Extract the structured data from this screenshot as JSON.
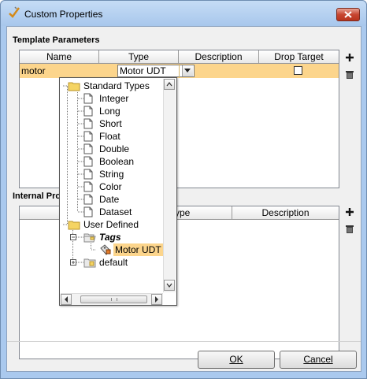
{
  "window": {
    "title": "Custom Properties"
  },
  "template_parameters": {
    "section_label": "Template Parameters",
    "columns": [
      "Name",
      "Type",
      "Description",
      "Drop Target"
    ],
    "rows": [
      {
        "name": "motor",
        "type": "Motor UDT",
        "description": "",
        "drop_target": false
      }
    ]
  },
  "type_dropdown": {
    "tree": [
      {
        "label": "Standard Types",
        "icon": "folder-icon",
        "expanded": true
      },
      {
        "label": "Integer",
        "icon": "page-icon"
      },
      {
        "label": "Long",
        "icon": "page-icon"
      },
      {
        "label": "Short",
        "icon": "page-icon"
      },
      {
        "label": "Float",
        "icon": "page-icon"
      },
      {
        "label": "Double",
        "icon": "page-icon"
      },
      {
        "label": "Boolean",
        "icon": "page-icon"
      },
      {
        "label": "String",
        "icon": "page-icon"
      },
      {
        "label": "Color",
        "icon": "page-icon"
      },
      {
        "label": "Date",
        "icon": "page-icon"
      },
      {
        "label": "Dataset",
        "icon": "page-icon"
      },
      {
        "label": "User Defined",
        "icon": "folder-icon",
        "expanded": true
      },
      {
        "label": "Tags",
        "icon": "open-folder-icon",
        "expanded": true
      },
      {
        "label": "Motor UDT",
        "icon": "udt-tag-icon",
        "selected": true
      },
      {
        "label": "default",
        "icon": "folder-icon",
        "expanded": false
      }
    ]
  },
  "internal_properties": {
    "section_label_visible": "Internal Pro",
    "columns_visible": [
      "ype",
      "Description"
    ]
  },
  "buttons": {
    "ok": "OK",
    "cancel": "Cancel"
  },
  "colors": {
    "selection": "#fcd58c",
    "title_bar": "#aac9ee",
    "close_button": "#c74631"
  }
}
